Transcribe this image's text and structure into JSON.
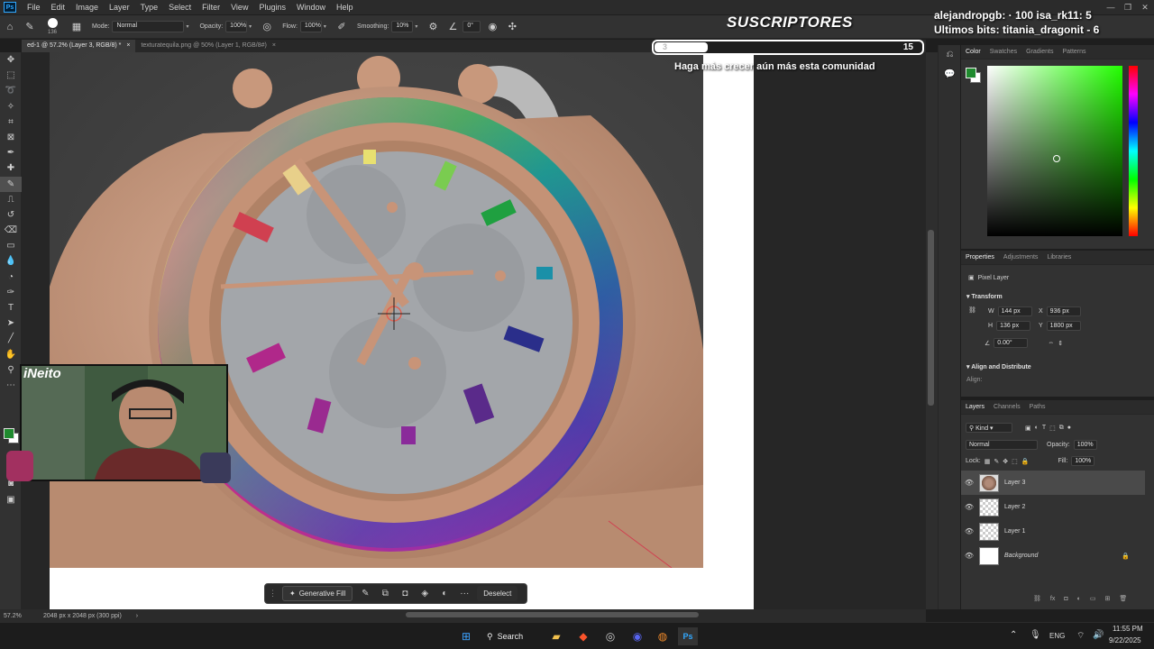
{
  "menubar": {
    "app_icon": "Ps",
    "items": [
      "File",
      "Edit",
      "Image",
      "Layer",
      "Type",
      "Select",
      "Filter",
      "View",
      "Plugins",
      "Window",
      "Help"
    ]
  },
  "options": {
    "brush_size": "136",
    "mode_label": "Mode:",
    "mode_value": "Normal",
    "opacity_label": "Opacity:",
    "opacity_value": "100%",
    "flow_label": "Flow:",
    "flow_value": "100%",
    "smoothing_label": "Smoothing:",
    "smoothing_value": "10%",
    "angle_value": "0°"
  },
  "tabs": [
    {
      "label": "ed-1 @ 57.2% (Layer 3, RGB/8) *",
      "close": "×"
    },
    {
      "label": "texturatequila.png @ 50% (Layer 1, RGB/8#)",
      "close": "×"
    }
  ],
  "status": {
    "zoom": "57.2%",
    "doc_size": "2048 px x 2048 px (300 ppi)",
    "arrow": "›"
  },
  "context_bar": {
    "generative_fill": "Generative Fill",
    "deselect": "Deselect",
    "more": "···"
  },
  "overlay": {
    "title": "SUSCRIPTORES",
    "bar_start": "3",
    "bar_goal": "15",
    "bar_progress": 0.2,
    "subtitle": "Haga más crecer aún más esta comunidad",
    "bits_line1": "alejandropgb: · 100   isa_rk11:   5",
    "bits_line2": "Ultimos bits: titania_dragonit - 6"
  },
  "color_panel": {
    "tabs": [
      "Color",
      "Swatches",
      "Gradients",
      "Patterns"
    ],
    "fg_color": "#1f8a2e"
  },
  "properties": {
    "tabs": [
      "Properties",
      "Adjustments",
      "Libraries"
    ],
    "kind": "Pixel Layer",
    "transform_title": "Transform",
    "w_label": "W",
    "w": "144 px",
    "h_label": "H",
    "h": "136 px",
    "x_label": "X",
    "x": "936 px",
    "y_label": "Y",
    "y": "1800 px",
    "angle": "0.00°",
    "align_title": "Align and Distribute",
    "align_label": "Align:"
  },
  "layers": {
    "tabs": [
      "Layers",
      "Channels",
      "Paths"
    ],
    "kind_label": "Kind",
    "blend_mode": "Normal",
    "opacity_label": "Opacity:",
    "opacity": "100%",
    "lock_label": "Lock:",
    "fill_label": "Fill:",
    "fill": "100%",
    "items": [
      {
        "name": "Layer 3"
      },
      {
        "name": "Layer 2"
      },
      {
        "name": "Layer 1"
      },
      {
        "name": "Background"
      }
    ]
  },
  "taskbar": {
    "search": "Search",
    "lang": "ENG",
    "time": "11:55 PM",
    "date": "9/22/2025"
  },
  "webcam": {
    "logo_text": "iNeito"
  }
}
